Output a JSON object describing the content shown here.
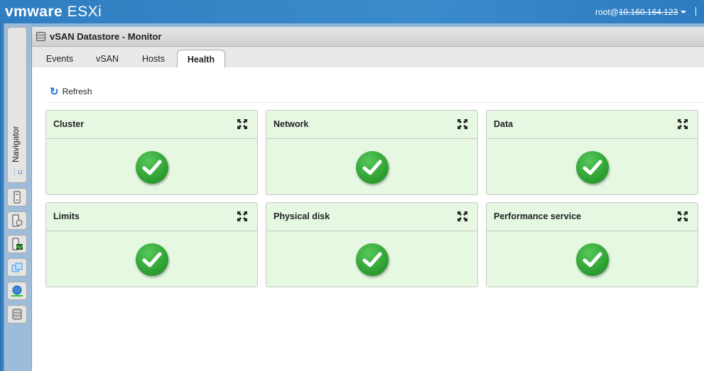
{
  "header": {
    "brand": "vmware",
    "product": "ESXi",
    "user": "root@",
    "host_redacted": "10.160.164.123"
  },
  "navigator": {
    "label": "Navigator",
    "icons": [
      "host-icon",
      "host-manage-icon",
      "host-monitor-icon",
      "virtual-machines-icon",
      "networking-icon",
      "storage-icon"
    ]
  },
  "panel": {
    "title": "vSAN Datastore - Monitor"
  },
  "tabs": [
    {
      "label": "Events"
    },
    {
      "label": "vSAN"
    },
    {
      "label": "Hosts"
    },
    {
      "label": "Health",
      "active": true
    }
  ],
  "toolbar": {
    "refresh": "Refresh"
  },
  "cards": [
    {
      "title": "Cluster",
      "status": "ok"
    },
    {
      "title": "Network",
      "status": "ok"
    },
    {
      "title": "Data",
      "status": "ok"
    },
    {
      "title": "Limits",
      "status": "ok"
    },
    {
      "title": "Physical disk",
      "status": "ok"
    },
    {
      "title": "Performance service",
      "status": "ok"
    }
  ],
  "colors": {
    "topbar": "#3a8bcc",
    "card_bg": "#e6f8e2",
    "ok": "#2a9c2e"
  }
}
